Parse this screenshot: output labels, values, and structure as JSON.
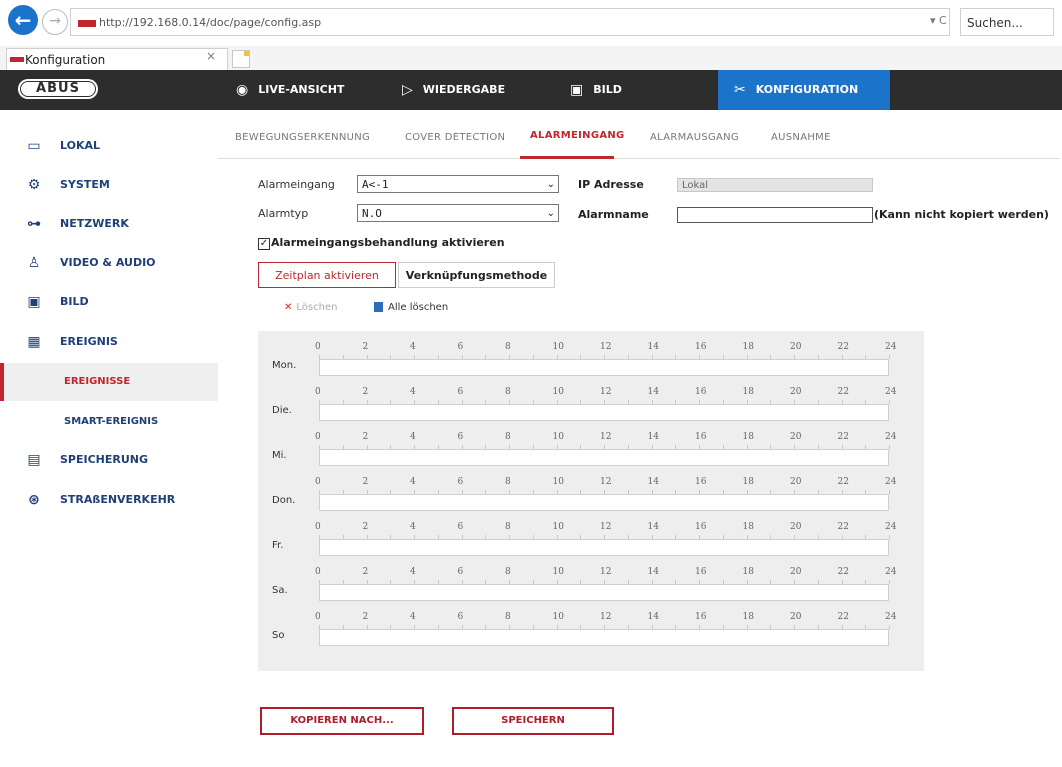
{
  "browser": {
    "url": "http://192.168.0.14/doc/page/config.asp",
    "search_placeholder": "Suchen...",
    "tab_title": "Konfiguration",
    "tab_close": "×",
    "refresh_glyph": "▾ C"
  },
  "brand": "ABUS",
  "topnav": [
    {
      "label": "LIVE-ANSICHT",
      "icon": "eye-icon",
      "glyph": "◉",
      "active": false
    },
    {
      "label": "WIEDERGABE",
      "icon": "play-icon",
      "glyph": "▷",
      "active": false
    },
    {
      "label": "BILD",
      "icon": "image-icon",
      "glyph": "▣",
      "active": false
    },
    {
      "label": "KONFIGURATION",
      "icon": "tools-icon",
      "glyph": "✂",
      "active": true
    }
  ],
  "sidebar": [
    {
      "label": "LOKAL",
      "icon": "monitor-icon",
      "glyph": "▭"
    },
    {
      "label": "SYSTEM",
      "icon": "gear-icon",
      "glyph": "⚙"
    },
    {
      "label": "NETZWERK",
      "icon": "network-icon",
      "glyph": "⊶"
    },
    {
      "label": "VIDEO & AUDIO",
      "icon": "microphone-icon",
      "glyph": "♙"
    },
    {
      "label": "BILD",
      "icon": "image-icon",
      "glyph": "▣"
    },
    {
      "label": "EREIGNIS",
      "icon": "calendar-icon",
      "glyph": "▦"
    },
    {
      "label": "EREIGNISSE",
      "sub": true,
      "selected": true
    },
    {
      "label": "SMART-EREIGNIS",
      "sub": true,
      "selected": false
    },
    {
      "label": "SPEICHERUNG",
      "icon": "storage-icon",
      "glyph": "▤"
    },
    {
      "label": "STRAßENVERKEHR",
      "icon": "car-search-icon",
      "glyph": "⊛"
    }
  ],
  "subtabs": [
    {
      "label": "BEWEGUNGSERKENNUNG",
      "active": false
    },
    {
      "label": "COVER DETECTION",
      "active": false
    },
    {
      "label": "ALARMEINGANG",
      "active": true
    },
    {
      "label": "ALARMAUSGANG",
      "active": false
    },
    {
      "label": "AUSNAHME",
      "active": false
    }
  ],
  "form": {
    "alarm_input_label": "Alarmeingang",
    "alarm_input_value": "A<-1",
    "alarm_type_label": "Alarmtyp",
    "alarm_type_value": "N.O",
    "ip_label": "IP Adresse",
    "ip_value": "Lokal",
    "alarm_name_label": "Alarmname",
    "alarm_name_value": "",
    "alarm_name_note": "(Kann nicht kopiert werden)",
    "enable_label": "Alarmeingangsbehandlung aktivieren",
    "enable_checked": true,
    "check_glyph": "✓"
  },
  "schedule_tabs": [
    {
      "label": "Zeitplan aktivieren",
      "active": true
    },
    {
      "label": "Verknüpfungsmethode",
      "active": false
    }
  ],
  "tools": {
    "delete_label": "Löschen",
    "delete_glyph": "✕",
    "delete_all_label": "Alle löschen"
  },
  "schedule": {
    "hours": [
      "0",
      "2",
      "4",
      "6",
      "8",
      "10",
      "12",
      "14",
      "16",
      "18",
      "20",
      "22",
      "24"
    ],
    "days": [
      "Mon.",
      "Die.",
      "Mi.",
      "Don.",
      "Fr.",
      "Sa.",
      "So"
    ]
  },
  "buttons": {
    "copy_label": "KOPIEREN NACH...",
    "save_label": "SPEICHERN"
  }
}
